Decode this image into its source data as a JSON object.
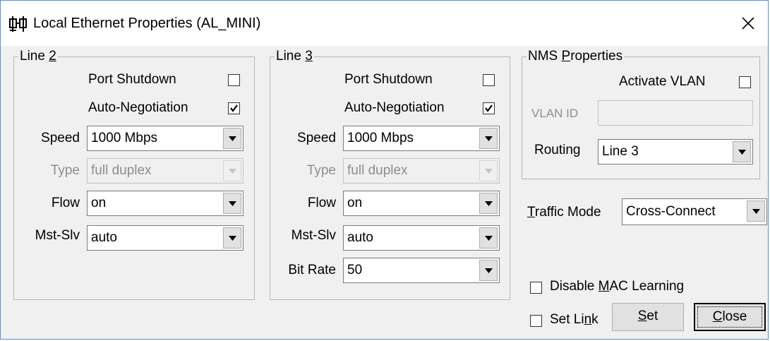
{
  "window": {
    "title": "Local Ethernet Properties (AL_MINI)",
    "app_icon": "network-app-icon",
    "close_icon": "close-icon"
  },
  "line2": {
    "legend_prefix": "Line ",
    "legend_key": "2",
    "port_shutdown": {
      "label": "Port Shutdown",
      "checked": false
    },
    "auto_negotiation": {
      "label": "Auto-Negotiation",
      "checked": true
    },
    "speed": {
      "label": "Speed",
      "value": "1000 Mbps"
    },
    "type": {
      "label": "Type",
      "value": "full duplex",
      "disabled": true
    },
    "flow": {
      "label": "Flow",
      "value": "on"
    },
    "mst_slv": {
      "label": "Mst-Slv",
      "value": "auto"
    }
  },
  "line3": {
    "legend_prefix": "Line ",
    "legend_key": "3",
    "port_shutdown": {
      "label": "Port Shutdown",
      "checked": false
    },
    "auto_negotiation": {
      "label": "Auto-Negotiation",
      "checked": true
    },
    "speed": {
      "label": "Speed",
      "value": "1000 Mbps"
    },
    "type": {
      "label": "Type",
      "value": "full duplex",
      "disabled": true
    },
    "flow": {
      "label": "Flow",
      "value": "on"
    },
    "mst_slv": {
      "label": "Mst-Slv",
      "value": "auto"
    },
    "bit_rate": {
      "label": "Bit Rate",
      "value": "50"
    }
  },
  "nms": {
    "legend_prefix": "NMS ",
    "legend_key": "P",
    "legend_rest": "roperties",
    "activate_vlan": {
      "label": "Activate VLAN",
      "checked": false
    },
    "vlan_id": {
      "label": "VLAN ID",
      "value": "",
      "disabled": true
    },
    "routing": {
      "label": "Routing",
      "value": "Line 3"
    }
  },
  "traffic_mode": {
    "label_key": "T",
    "label_rest": "raffic Mode",
    "value": "Cross-Connect"
  },
  "disable_mac": {
    "label_prefix": "Disable ",
    "label_key": "M",
    "label_rest": "AC Learning",
    "checked": false
  },
  "set_link": {
    "label_prefix": "Set Li",
    "label_key": "n",
    "label_rest": "k",
    "checked": false
  },
  "buttons": {
    "set": {
      "key": "S",
      "rest": "et"
    },
    "close": {
      "key": "C",
      "rest": "lose"
    }
  }
}
